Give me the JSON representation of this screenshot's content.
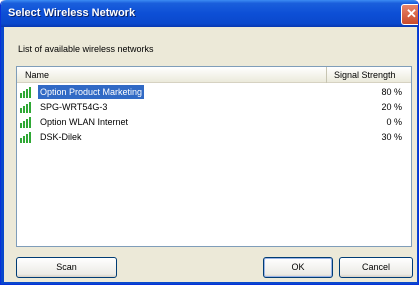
{
  "window": {
    "title": "Select Wireless Network",
    "close_label": "✕"
  },
  "dialog": {
    "list_label": "List of available wireless networks"
  },
  "list": {
    "columns": [
      "Name",
      "Signal Strength"
    ],
    "rows": [
      {
        "name": "Option Product Marketing",
        "signal": "80 %",
        "selected": true
      },
      {
        "name": "SPG-WRT54G-3",
        "signal": "20 %",
        "selected": false
      },
      {
        "name": "Option WLAN Internet",
        "signal": "0 %",
        "selected": false
      },
      {
        "name": "DSK-Dilek",
        "signal": "30 %",
        "selected": false
      }
    ]
  },
  "buttons": {
    "scan": "Scan",
    "ok": "OK",
    "cancel": "Cancel"
  },
  "icons": {
    "network": "wireless-signal-icon"
  },
  "colors": {
    "titlebar": "#0a48cc",
    "selection": "#316ac5",
    "dialog_bg": "#ece9d8",
    "icon_green": "#2fa835"
  }
}
